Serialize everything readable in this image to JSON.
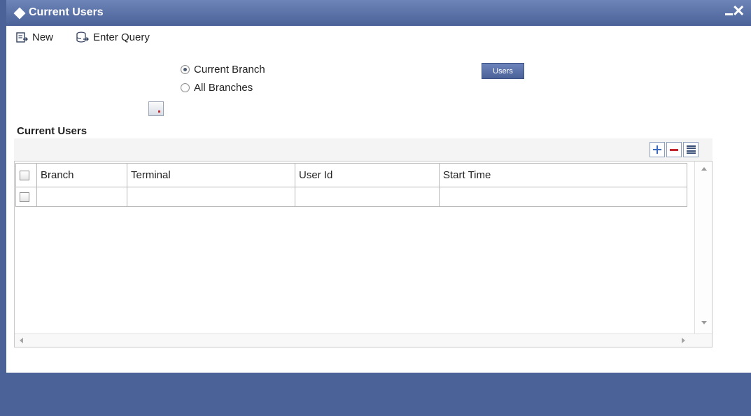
{
  "window": {
    "title": "Current Users",
    "minimize_icon": "minimize-icon",
    "close_glyph": "✕",
    "colors": {
      "titlebar": "#4a6298",
      "footer": "#4a6298",
      "accent_red": "#c3262e",
      "accent_blue": "#3a6bc1"
    }
  },
  "toolbar": {
    "new_label": "New",
    "new_icon": "new-record-icon",
    "enter_query_label": "Enter Query",
    "enter_query_icon": "enter-query-icon"
  },
  "options": {
    "current_branch_label": "Current Branch",
    "current_branch_selected": true,
    "all_branches_label": "All Branches",
    "all_branches_selected": false,
    "users_button_label": "Users",
    "lov_icon": "list-of-values-icon"
  },
  "section": {
    "title": "Current Users"
  },
  "grid": {
    "toolbar_icons": [
      "add-row-icon",
      "delete-row-icon",
      "single-view-icon"
    ],
    "columns": [
      "Branch",
      "Terminal",
      "User Id",
      "Start Time"
    ],
    "rows": [
      {
        "checked": false,
        "cells": [
          "",
          "",
          "",
          ""
        ]
      }
    ]
  }
}
